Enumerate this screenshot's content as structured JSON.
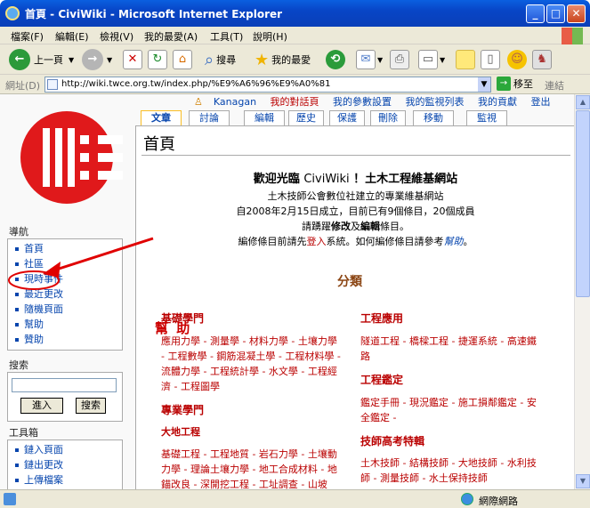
{
  "window": {
    "title": "首頁 - CiviWiki - Microsoft Internet Explorer",
    "min": "_",
    "max": "□",
    "close": "✕"
  },
  "menu": [
    "檔案(F)",
    "編輯(E)",
    "檢視(V)",
    "我的最愛(A)",
    "工具(T)",
    "說明(H)"
  ],
  "toolbar": {
    "back": "上一頁",
    "search": "搜尋",
    "favorites": "我的最愛"
  },
  "address": {
    "label": "網址(D)",
    "url": "http://wiki.twce.org.tw/index.php/%E9%A6%96%E9%A0%81",
    "go": "移至",
    "links": "連結"
  },
  "personal": {
    "user": "Kanagan",
    "talk": "我的對話頁",
    "prefs": "我的參數設置",
    "watch": "我的監視列表",
    "contrib": "我的貢獻",
    "logout": "登出"
  },
  "tabs": [
    "文章",
    "討論",
    "編輯",
    "歷史",
    "保護",
    "刪除",
    "移動",
    "監視"
  ],
  "page": {
    "title": "首頁",
    "welcome_a": "歡迎光臨 ",
    "welcome_site": "CiviWiki",
    "welcome_b": " ！土木工程維基網站",
    "line1": "土木技師公會數位社建立的專業維基網站",
    "line2a": "自2008年2月15日成立，目前已有9個條目，20個成員",
    "line3a": "請踴躍",
    "line3b": "修改",
    "line3c": "及",
    "line3d": "編輯",
    "line3e": "條目。",
    "line4a": "編修條目前請先",
    "line4b": "登入",
    "line4c": "系統。如何編修條目請參考",
    "line4d": "幫助",
    "line4e": "。",
    "categories": "分類"
  },
  "annotation": "幫 助",
  "nav": {
    "heading": "導航",
    "items": [
      "首頁",
      "社區",
      "現時事件",
      "最近更改",
      "隨機頁面",
      "幫助",
      "贊助"
    ]
  },
  "search": {
    "heading": "搜索",
    "go": "進入",
    "search": "搜索"
  },
  "tools": {
    "heading": "工具箱",
    "items": [
      "鏈入頁面",
      "鏈出更改",
      "上傳檔案"
    ]
  },
  "left_cats": [
    {
      "title": "基礎學門",
      "body": "應用力學 - 測量學 - 材料力學 - 土壤力學 - 工程數學 - 鋼筋混凝土學 - 工程材料學 - 流體力學 - 工程統計學 - 水文學 - 工程經濟 - 工程圖學"
    },
    {
      "title": "專業學門",
      "body": ""
    },
    {
      "title": "大地工程",
      "body": "基礎工程 - 工程地質 - 岩石力學 - 土壤動力學 - 理論土壤力學 - 地工合成材料 - 地錨改良 - 深開挖工程 - 工址調查 - 山坡"
    }
  ],
  "right_cats": [
    {
      "title": "工程應用",
      "body": "隧道工程 - 橋樑工程 - 捷運系統 - 高速鐵路"
    },
    {
      "title": "工程鑑定",
      "body": "鑑定手冊 - 現況鑑定 - 施工損鄰鑑定 - 安全鑑定 -"
    },
    {
      "title": "技師高考特輯",
      "body": "土木技師 - 結構技師 - 大地技師 - 水利技師 - 測量技師 - 水土保持技師"
    }
  ],
  "status": {
    "zone": "網際網路"
  },
  "colors": {
    "link": "#0645ad",
    "red": "#ba0000",
    "titlebar": "#0845c6"
  }
}
